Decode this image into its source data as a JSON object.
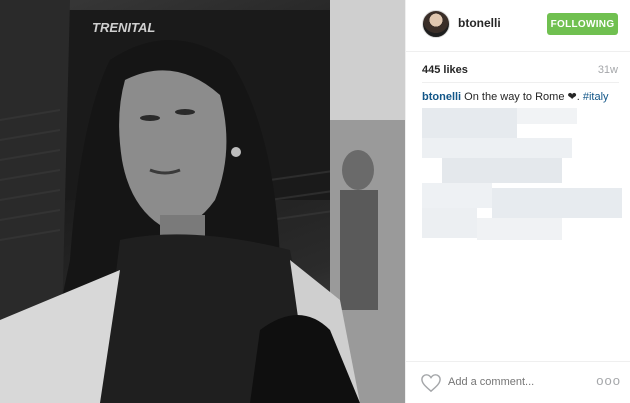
{
  "photo": {
    "seat_brand": "TRENITAL"
  },
  "header": {
    "username": "btonelli",
    "follow_label": "FOLLOWING",
    "follow_color": "#70c050"
  },
  "stats": {
    "likes": "445 likes",
    "time": "31w"
  },
  "caption": {
    "username": "btonelli",
    "text": "On the way to Rome ❤.",
    "hashtag": "#italy"
  },
  "footer": {
    "comment_placeholder": "Add a comment...",
    "more_label": "ooo"
  },
  "icons": {
    "like": "heart-icon",
    "more": "more-options-icon"
  }
}
